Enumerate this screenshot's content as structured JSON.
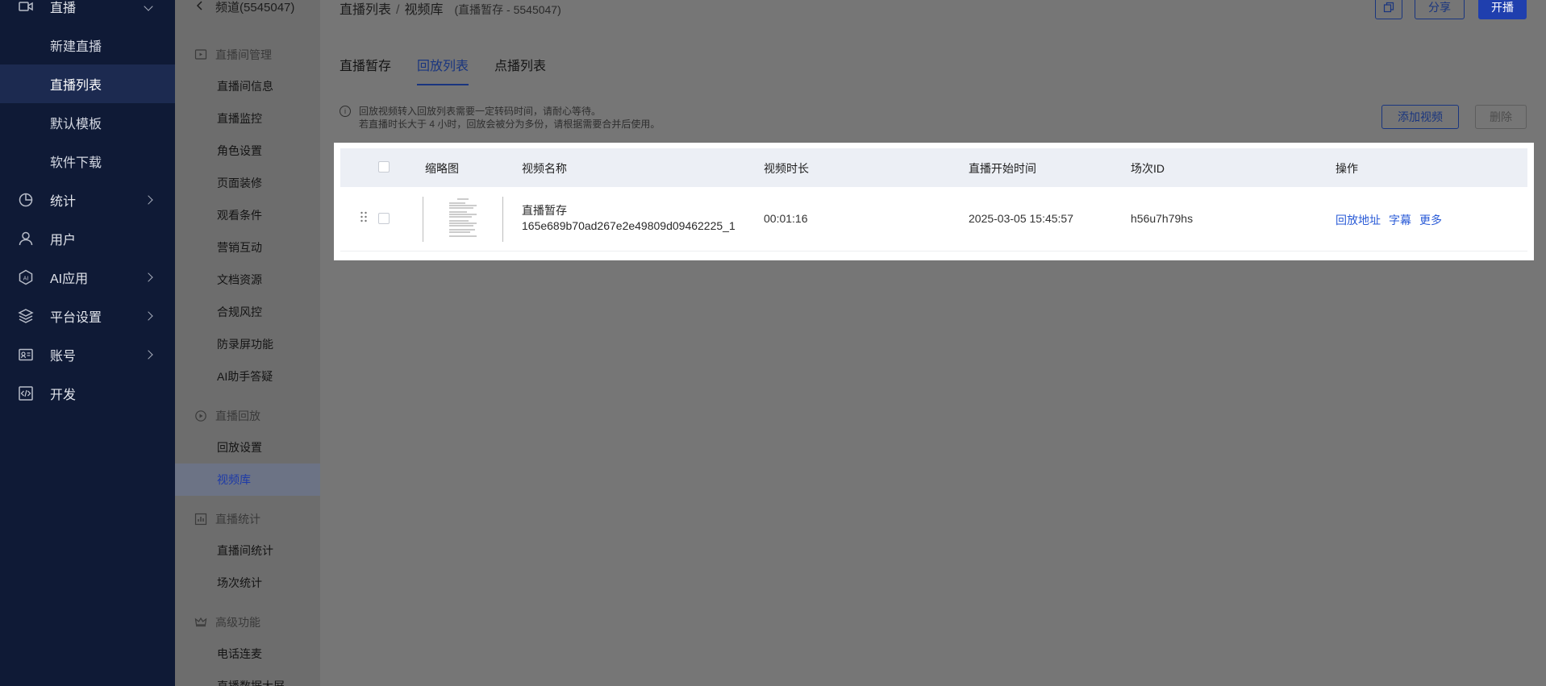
{
  "sidebar": {
    "live": "直播",
    "sub_items": [
      "新建直播",
      "直播列表",
      "默认模板",
      "软件下载"
    ],
    "active_sub": "直播列表",
    "items": [
      "统计",
      "用户",
      "AI应用",
      "平台设置",
      "账号",
      "开发"
    ]
  },
  "subnav": {
    "back_label": "频道(5545047)",
    "groups": [
      {
        "title": "直播间管理",
        "links": [
          "直播间信息",
          "直播监控",
          "角色设置",
          "页面装修",
          "观看条件",
          "营销互动",
          "文档资源",
          "合规风控",
          "防录屏功能",
          "AI助手答疑"
        ]
      },
      {
        "title": "直播回放",
        "links": [
          "回放设置",
          "视频库"
        ]
      },
      {
        "title": "直播统计",
        "links": [
          "直播间统计",
          "场次统计"
        ]
      },
      {
        "title": "高级功能",
        "links": [
          "电话连麦",
          "直播数据大屏"
        ]
      }
    ],
    "active_link": "视频库"
  },
  "header": {
    "crumb_1": "直播列表",
    "crumb_sep": "/",
    "crumb_2": "视频库",
    "crumb_sub": "(直播暂存 - 5545047)",
    "share_label": "分享",
    "start_label": "开播"
  },
  "tabs": [
    "直播暂存",
    "回放列表",
    "点播列表"
  ],
  "active_tab": "回放列表",
  "notice": {
    "line1": "回放视频转入回放列表需要一定转码时间，请耐心等待。",
    "line2": "若直播时长大于 4 小时，回放会被分为多份，请根据需要合并后使用。"
  },
  "actions": {
    "add_video": "添加视频",
    "delete": "删除"
  },
  "table": {
    "columns": [
      "缩略图",
      "视频名称",
      "视频时长",
      "直播开始时间",
      "场次ID",
      "操作"
    ],
    "rows": [
      {
        "name_line1": "直播暂存",
        "name_line2": "165e689b70ad267e2e49809d09462225_1",
        "duration": "00:01:16",
        "start_time": "2025-03-05 15:45:57",
        "session_id": "h56u7h79hs",
        "ops": [
          "回放地址",
          "字幕",
          "更多"
        ]
      }
    ]
  }
}
